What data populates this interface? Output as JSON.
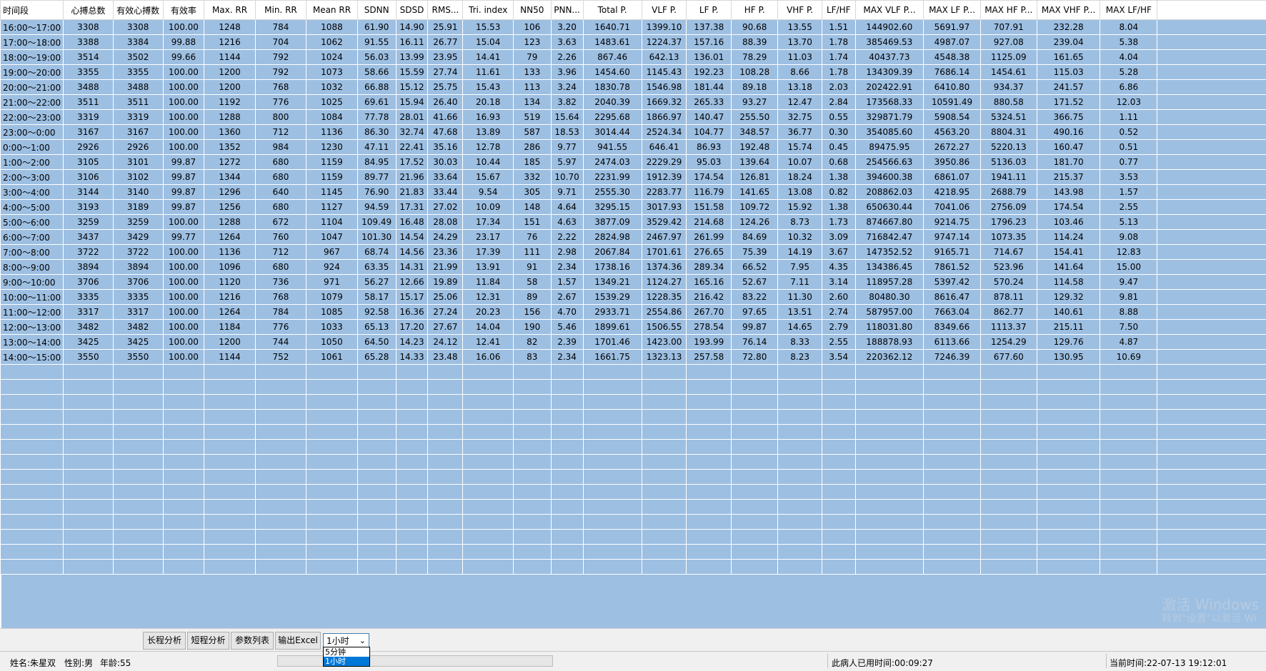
{
  "table": {
    "columns": [
      "时间段",
      "心搏总数",
      "有效心搏数",
      "有效率",
      "Max. RR",
      "Min. RR",
      "Mean RR",
      "SDNN",
      "SDSD",
      "RMS...",
      "Tri. index",
      "NN50",
      "PNN...",
      "Total P.",
      "VLF P.",
      "LF P.",
      "HF P.",
      "VHF P.",
      "LF/HF",
      "MAX VLF P...",
      "MAX LF P...",
      "MAX HF P...",
      "MAX VHF P...",
      "MAX LF/HF"
    ],
    "rows": [
      [
        "16:00～17:00",
        "3308",
        "3308",
        "100.00",
        "1248",
        "784",
        "1088",
        "61.90",
        "14.90",
        "25.91",
        "15.53",
        "106",
        "3.20",
        "1640.71",
        "1399.10",
        "137.38",
        "90.68",
        "13.55",
        "1.51",
        "144902.60",
        "5691.97",
        "707.91",
        "232.28",
        "8.04"
      ],
      [
        "17:00～18:00",
        "3388",
        "3384",
        "99.88",
        "1216",
        "704",
        "1062",
        "91.55",
        "16.11",
        "26.77",
        "15.04",
        "123",
        "3.63",
        "1483.61",
        "1224.37",
        "157.16",
        "88.39",
        "13.70",
        "1.78",
        "385469.53",
        "4987.07",
        "927.08",
        "239.04",
        "5.38"
      ],
      [
        "18:00～19:00",
        "3514",
        "3502",
        "99.66",
        "1144",
        "792",
        "1024",
        "56.03",
        "13.99",
        "23.95",
        "14.41",
        "79",
        "2.26",
        "867.46",
        "642.13",
        "136.01",
        "78.29",
        "11.03",
        "1.74",
        "40437.73",
        "4548.38",
        "1125.09",
        "161.65",
        "4.04"
      ],
      [
        "19:00～20:00",
        "3355",
        "3355",
        "100.00",
        "1200",
        "792",
        "1073",
        "58.66",
        "15.59",
        "27.74",
        "11.61",
        "133",
        "3.96",
        "1454.60",
        "1145.43",
        "192.23",
        "108.28",
        "8.66",
        "1.78",
        "134309.39",
        "7686.14",
        "1454.61",
        "115.03",
        "5.28"
      ],
      [
        "20:00～21:00",
        "3488",
        "3488",
        "100.00",
        "1200",
        "768",
        "1032",
        "66.88",
        "15.12",
        "25.75",
        "15.43",
        "113",
        "3.24",
        "1830.78",
        "1546.98",
        "181.44",
        "89.18",
        "13.18",
        "2.03",
        "202422.91",
        "6410.80",
        "934.37",
        "241.57",
        "6.86"
      ],
      [
        "21:00～22:00",
        "3511",
        "3511",
        "100.00",
        "1192",
        "776",
        "1025",
        "69.61",
        "15.94",
        "26.40",
        "20.18",
        "134",
        "3.82",
        "2040.39",
        "1669.32",
        "265.33",
        "93.27",
        "12.47",
        "2.84",
        "173568.33",
        "10591.49",
        "880.58",
        "171.52",
        "12.03"
      ],
      [
        "22:00～23:00",
        "3319",
        "3319",
        "100.00",
        "1288",
        "800",
        "1084",
        "77.78",
        "28.01",
        "41.66",
        "16.93",
        "519",
        "15.64",
        "2295.68",
        "1866.97",
        "140.47",
        "255.50",
        "32.75",
        "0.55",
        "329871.79",
        "5908.54",
        "5324.51",
        "366.75",
        "1.11"
      ],
      [
        "23:00～0:00",
        "3167",
        "3167",
        "100.00",
        "1360",
        "712",
        "1136",
        "86.30",
        "32.74",
        "47.68",
        "13.89",
        "587",
        "18.53",
        "3014.44",
        "2524.34",
        "104.77",
        "348.57",
        "36.77",
        "0.30",
        "354085.60",
        "4563.20",
        "8804.31",
        "490.16",
        "0.52"
      ],
      [
        "0:00～1:00",
        "2926",
        "2926",
        "100.00",
        "1352",
        "984",
        "1230",
        "47.11",
        "22.41",
        "35.16",
        "12.78",
        "286",
        "9.77",
        "941.55",
        "646.41",
        "86.93",
        "192.48",
        "15.74",
        "0.45",
        "89475.95",
        "2672.27",
        "5220.13",
        "160.47",
        "0.51"
      ],
      [
        "1:00～2:00",
        "3105",
        "3101",
        "99.87",
        "1272",
        "680",
        "1159",
        "84.95",
        "17.52",
        "30.03",
        "10.44",
        "185",
        "5.97",
        "2474.03",
        "2229.29",
        "95.03",
        "139.64",
        "10.07",
        "0.68",
        "254566.63",
        "3950.86",
        "5136.03",
        "181.70",
        "0.77"
      ],
      [
        "2:00～3:00",
        "3106",
        "3102",
        "99.87",
        "1344",
        "680",
        "1159",
        "89.77",
        "21.96",
        "33.64",
        "15.67",
        "332",
        "10.70",
        "2231.99",
        "1912.39",
        "174.54",
        "126.81",
        "18.24",
        "1.38",
        "394600.38",
        "6861.07",
        "1941.11",
        "215.37",
        "3.53"
      ],
      [
        "3:00～4:00",
        "3144",
        "3140",
        "99.87",
        "1296",
        "640",
        "1145",
        "76.90",
        "21.83",
        "33.44",
        "9.54",
        "305",
        "9.71",
        "2555.30",
        "2283.77",
        "116.79",
        "141.65",
        "13.08",
        "0.82",
        "208862.03",
        "4218.95",
        "2688.79",
        "143.98",
        "1.57"
      ],
      [
        "4:00～5:00",
        "3193",
        "3189",
        "99.87",
        "1256",
        "680",
        "1127",
        "94.59",
        "17.31",
        "27.02",
        "10.09",
        "148",
        "4.64",
        "3295.15",
        "3017.93",
        "151.58",
        "109.72",
        "15.92",
        "1.38",
        "650630.44",
        "7041.06",
        "2756.09",
        "174.54",
        "2.55"
      ],
      [
        "5:00～6:00",
        "3259",
        "3259",
        "100.00",
        "1288",
        "672",
        "1104",
        "109.49",
        "16.48",
        "28.08",
        "17.34",
        "151",
        "4.63",
        "3877.09",
        "3529.42",
        "214.68",
        "124.26",
        "8.73",
        "1.73",
        "874667.80",
        "9214.75",
        "1796.23",
        "103.46",
        "5.13"
      ],
      [
        "6:00～7:00",
        "3437",
        "3429",
        "99.77",
        "1264",
        "760",
        "1047",
        "101.30",
        "14.54",
        "24.29",
        "23.17",
        "76",
        "2.22",
        "2824.98",
        "2467.97",
        "261.99",
        "84.69",
        "10.32",
        "3.09",
        "716842.47",
        "9747.14",
        "1073.35",
        "114.24",
        "9.08"
      ],
      [
        "7:00～8:00",
        "3722",
        "3722",
        "100.00",
        "1136",
        "712",
        "967",
        "68.74",
        "14.56",
        "23.36",
        "17.39",
        "111",
        "2.98",
        "2067.84",
        "1701.61",
        "276.65",
        "75.39",
        "14.19",
        "3.67",
        "147352.52",
        "9165.71",
        "714.67",
        "154.41",
        "12.83"
      ],
      [
        "8:00～9:00",
        "3894",
        "3894",
        "100.00",
        "1096",
        "680",
        "924",
        "63.35",
        "14.31",
        "21.99",
        "13.91",
        "91",
        "2.34",
        "1738.16",
        "1374.36",
        "289.34",
        "66.52",
        "7.95",
        "4.35",
        "134386.45",
        "7861.52",
        "523.96",
        "141.64",
        "15.00"
      ],
      [
        "9:00～10:00",
        "3706",
        "3706",
        "100.00",
        "1120",
        "736",
        "971",
        "56.27",
        "12.66",
        "19.89",
        "11.84",
        "58",
        "1.57",
        "1349.21",
        "1124.27",
        "165.16",
        "52.67",
        "7.11",
        "3.14",
        "118957.28",
        "5397.42",
        "570.24",
        "114.58",
        "9.47"
      ],
      [
        "10:00～11:00",
        "3335",
        "3335",
        "100.00",
        "1216",
        "768",
        "1079",
        "58.17",
        "15.17",
        "25.06",
        "12.31",
        "89",
        "2.67",
        "1539.29",
        "1228.35",
        "216.42",
        "83.22",
        "11.30",
        "2.60",
        "80480.30",
        "8616.47",
        "878.11",
        "129.32",
        "9.81"
      ],
      [
        "11:00～12:00",
        "3317",
        "3317",
        "100.00",
        "1264",
        "784",
        "1085",
        "92.58",
        "16.36",
        "27.24",
        "20.23",
        "156",
        "4.70",
        "2933.71",
        "2554.86",
        "267.70",
        "97.65",
        "13.51",
        "2.74",
        "587957.00",
        "7663.04",
        "862.77",
        "140.61",
        "8.88"
      ],
      [
        "12:00～13:00",
        "3482",
        "3482",
        "100.00",
        "1184",
        "776",
        "1033",
        "65.13",
        "17.20",
        "27.67",
        "14.04",
        "190",
        "5.46",
        "1899.61",
        "1506.55",
        "278.54",
        "99.87",
        "14.65",
        "2.79",
        "118031.80",
        "8349.66",
        "1113.37",
        "215.11",
        "7.50"
      ],
      [
        "13:00～14:00",
        "3425",
        "3425",
        "100.00",
        "1200",
        "744",
        "1050",
        "64.50",
        "14.23",
        "24.12",
        "12.41",
        "82",
        "2.39",
        "1701.46",
        "1423.00",
        "193.99",
        "76.14",
        "8.33",
        "2.55",
        "188878.93",
        "6113.66",
        "1254.29",
        "129.76",
        "4.87"
      ],
      [
        "14:00～15:00",
        "3550",
        "3550",
        "100.00",
        "1144",
        "752",
        "1061",
        "65.28",
        "14.33",
        "23.48",
        "16.06",
        "83",
        "2.34",
        "1661.75",
        "1323.13",
        "257.58",
        "72.80",
        "8.23",
        "3.54",
        "220362.12",
        "7246.39",
        "677.60",
        "130.95",
        "10.69"
      ]
    ]
  },
  "toolbar": {
    "long_analysis": "长程分析",
    "short_analysis": "短程分析",
    "param_list": "参数列表",
    "export_excel": "输出Excel",
    "interval_select": "1小时",
    "interval_options": [
      "5分钟",
      "1小时"
    ]
  },
  "status": {
    "name": "姓名:朱星双",
    "gender": "性别:男",
    "age": "年龄:55",
    "elapsed": "此病人已用时间:00:09:27",
    "current_time": "当前时间:22-07-13 19:12:01"
  },
  "watermark": {
    "line1": "激活 Windows",
    "line2": "转到\"设置\"以激活 Wi"
  }
}
